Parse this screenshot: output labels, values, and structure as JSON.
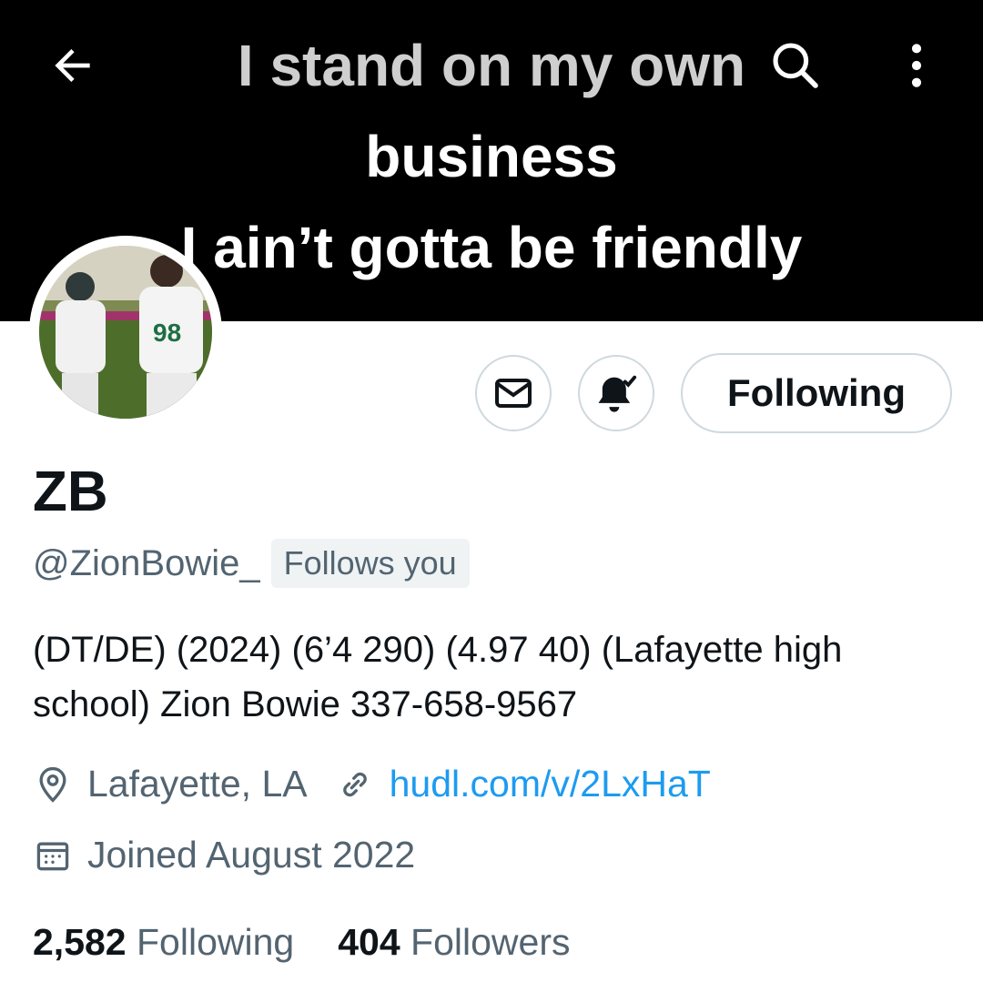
{
  "banner": {
    "line1": "I  stand on my own",
    "line2": "business",
    "line3": "I ain’t gotta be friendly"
  },
  "profile": {
    "name": "ZB",
    "handle": "@ZionBowie_",
    "follows_you": "Follows you",
    "bio": "(DT/DE) (2024) (6’4 290) (4.97 40) (Lafayette high school) Zion Bowie 337-658-9567",
    "location": "Lafayette, LA",
    "website": "hudl.com/v/2LxHaT",
    "joined": "Joined August 2022"
  },
  "actions": {
    "following_label": "Following"
  },
  "stats": {
    "following_count": "2,582",
    "following_label": "Following",
    "followers_count": "404",
    "followers_label": "Followers"
  },
  "icons": {
    "back": "arrow-left-icon",
    "search": "search-icon",
    "more": "more-vertical-icon",
    "message": "envelope-icon",
    "notifications": "bell-check-icon",
    "location": "location-pin-icon",
    "link": "link-icon",
    "calendar": "calendar-icon"
  },
  "colors": {
    "link": "#1d9bf0",
    "secondary_text": "#536471",
    "primary_text": "#0f1419",
    "border": "#cfd9de"
  }
}
